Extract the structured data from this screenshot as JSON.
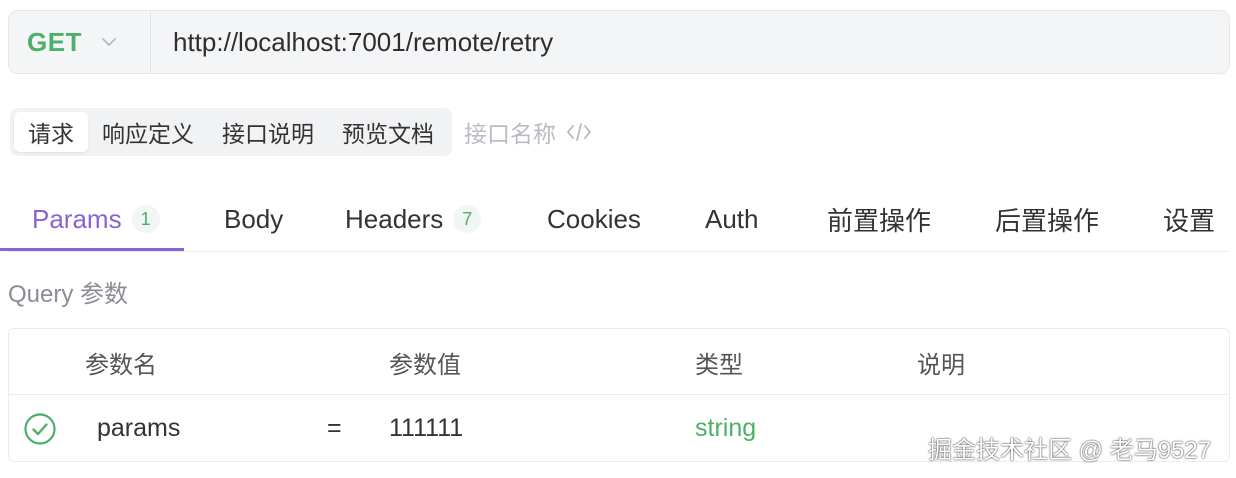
{
  "request": {
    "method": "GET",
    "url": "http://localhost:7001/remote/retry"
  },
  "segments": {
    "items": [
      "请求",
      "响应定义",
      "接口说明",
      "预览文档"
    ],
    "active_index": 0,
    "name_placeholder": "接口名称"
  },
  "tabs": {
    "items": [
      {
        "label": "Params",
        "badge": "1"
      },
      {
        "label": "Body"
      },
      {
        "label": "Headers",
        "badge": "7"
      },
      {
        "label": "Cookies"
      },
      {
        "label": "Auth"
      },
      {
        "label": "前置操作"
      },
      {
        "label": "后置操作"
      },
      {
        "label": "设置"
      }
    ],
    "active_index": 0
  },
  "query": {
    "title": "Query 参数",
    "columns": [
      "参数名",
      "参数值",
      "类型",
      "说明"
    ],
    "rows": [
      {
        "enabled": true,
        "name": "params",
        "operator": "=",
        "value": "111111",
        "type": "string",
        "description": ""
      }
    ]
  },
  "watermark": "掘金技术社区 @ 老马9527",
  "colors": {
    "accent": "#8a63d2",
    "method": "#4caf6a",
    "type": "#4caf6a"
  }
}
